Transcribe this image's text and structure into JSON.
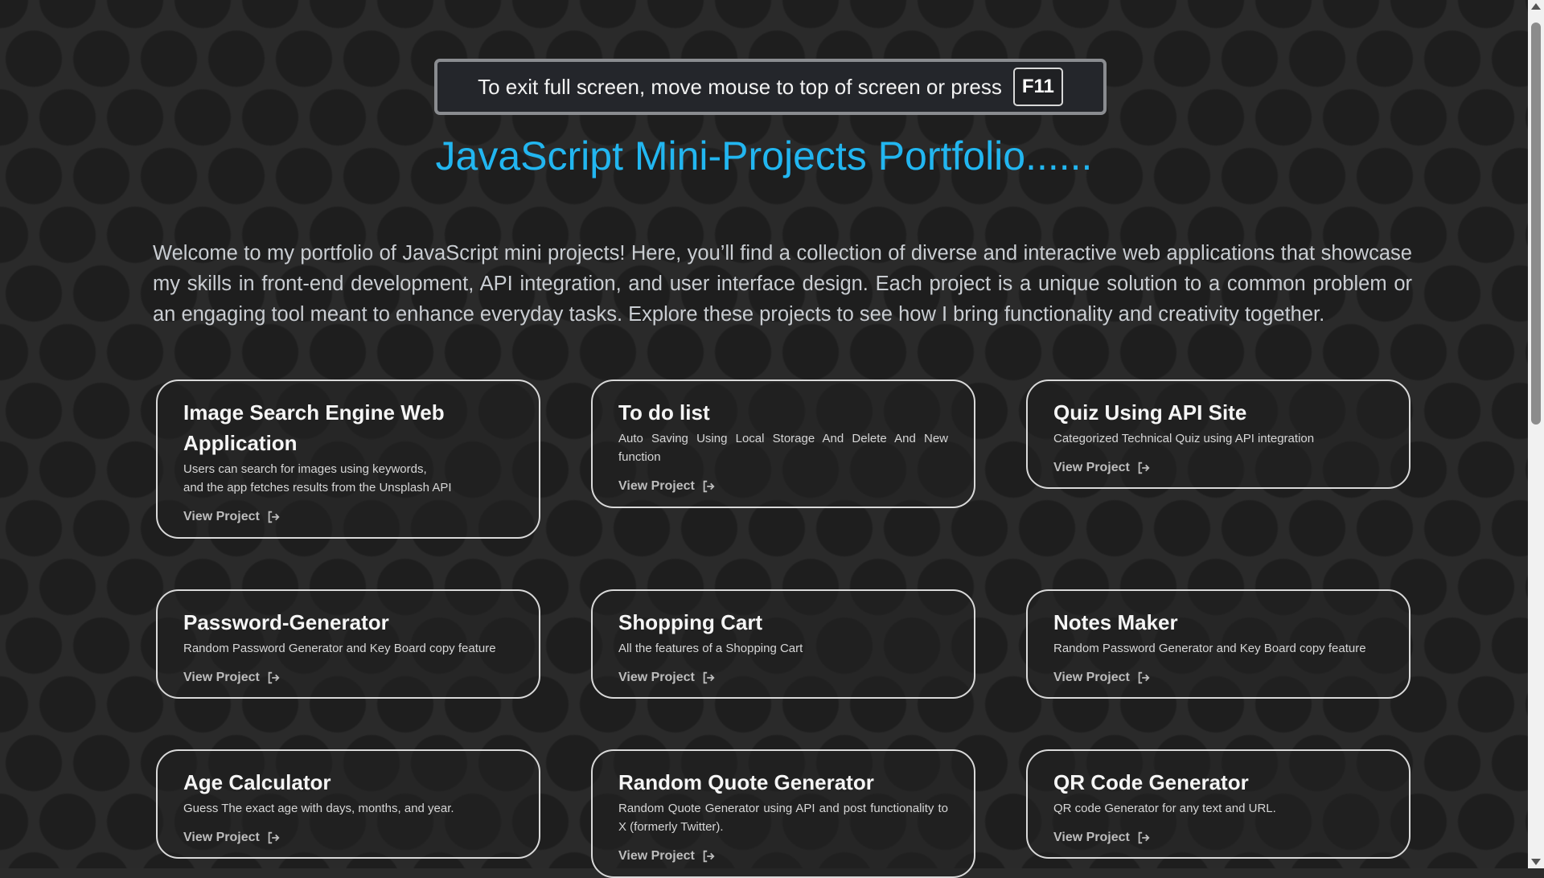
{
  "fullscreen_notice": {
    "text": "To exit full screen, move mouse to top of screen or press",
    "key": "F11"
  },
  "header": {
    "title": "JavaScript Mini-Projects Portfolio......"
  },
  "intro": {
    "text": "Welcome to my portfolio of JavaScript mini projects! Here, you’ll find a collection of diverse and interactive web applications that showcase my skills in front-end development, API integration, and user interface design. Each project is a unique solution to a common problem or an engaging tool meant to enhance everyday tasks. Explore these projects to see how I bring functionality and creativity together."
  },
  "projects": [
    {
      "title": "Image Search Engine Web Application",
      "desc_lines": [
        "Users can search for images using keywords,",
        "and the app fetches results from the Unsplash API"
      ],
      "link": "View Project"
    },
    {
      "title": "To do list",
      "desc": "Auto Saving Using Local Storage And Delete And New function",
      "link": "View Project"
    },
    {
      "title": "Quiz Using API Site",
      "desc": "Categorized Technical Quiz using API integration",
      "link": "View Project"
    },
    {
      "title": "Password-Generator",
      "desc": "Random Password Generator and Key Board copy feature",
      "link": "View Project"
    },
    {
      "title": "Shopping Cart",
      "desc": "All the features of a Shopping Cart",
      "link": "View Project"
    },
    {
      "title": "Notes Maker",
      "desc": "Random Password Generator and Key Board copy feature",
      "link": "View Project"
    },
    {
      "title": "Age Calculator",
      "desc": "Guess The exact age with days, months, and year.",
      "link": "View Project"
    },
    {
      "title": "Random Quote Generator",
      "desc": "Random Quote Generator using API and post functionality to X (formerly Twitter).",
      "link": "View Project"
    },
    {
      "title": "QR Code Generator",
      "desc": "QR code Generator for any text and URL.",
      "link": "View Project"
    }
  ],
  "colors": {
    "accent": "#22b6f0",
    "background": "#2b2b2b",
    "card_border": "#d9d9d9"
  },
  "icons": {
    "view_project": "external-link-icon"
  }
}
